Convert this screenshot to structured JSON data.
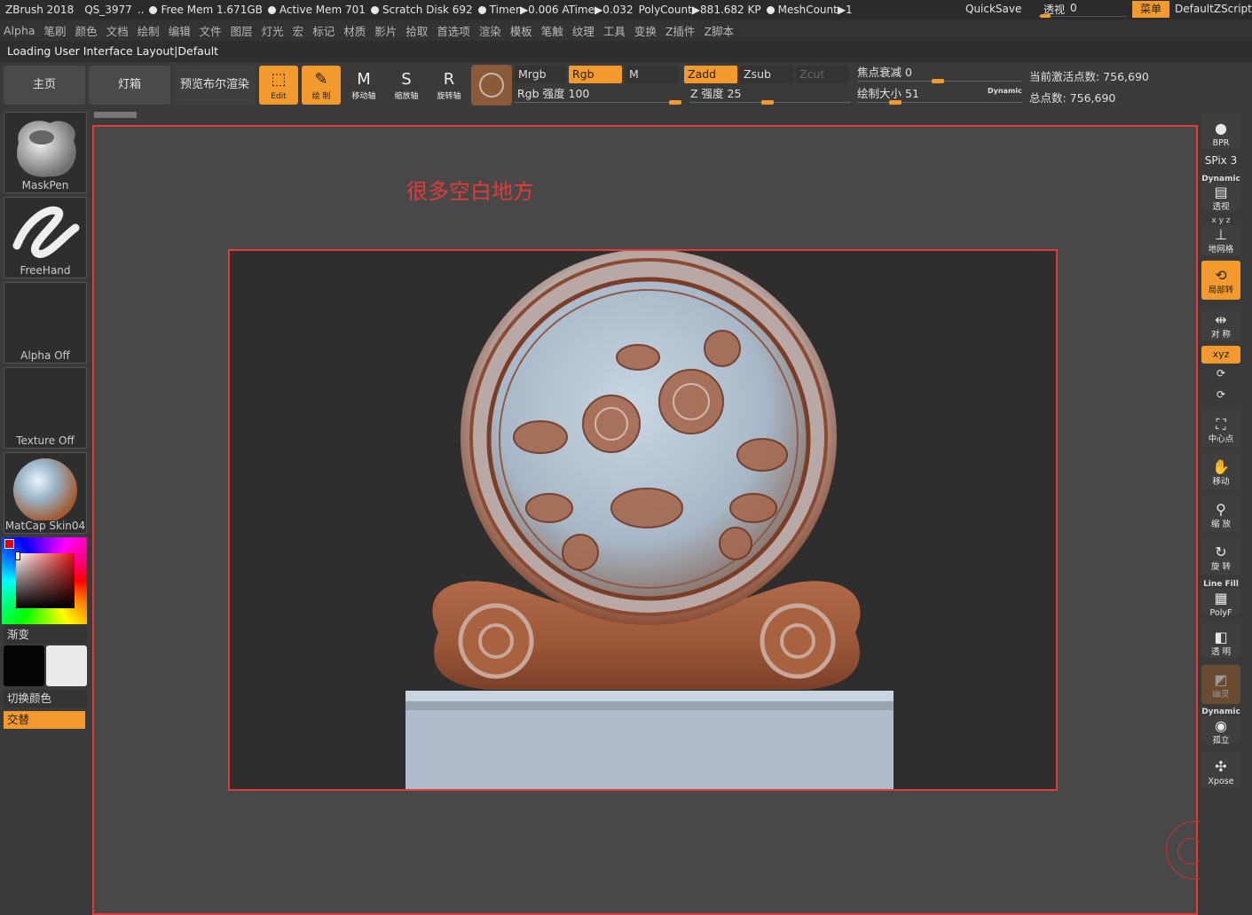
{
  "titlebar": {
    "app": "ZBrush 2018",
    "qs": "QS_3977",
    "ellipsis": "..",
    "free_mem": "Free Mem 1.671GB",
    "active_mem": "Active Mem 701",
    "scratch_disk": "Scratch Disk 692",
    "timer": "Timer▶0.006 ATime▶0.032",
    "polycount": "PolyCount▶881.682 KP",
    "meshcount": "MeshCount▶1",
    "quicksave": "QuickSave",
    "perspective_label": "透视",
    "perspective_value": "0",
    "menu_button": "菜单",
    "default_zscript": "DefaultZScript"
  },
  "menubar": {
    "items": [
      "Alpha",
      "笔刷",
      "颜色",
      "文档",
      "绘制",
      "编辑",
      "文件",
      "图层",
      "灯光",
      "宏",
      "标记",
      "材质",
      "影片",
      "拾取",
      "首选项",
      "渲染",
      "模板",
      "笔触",
      "纹理",
      "工具",
      "变换",
      "Z插件",
      "Z脚本"
    ]
  },
  "status_line": "Loading User Interface Layout|Default",
  "toolbar": {
    "home": "主页",
    "lightbox": "灯箱",
    "preview_bool": "预览布尔渲染",
    "edit": {
      "glyph": "⬚",
      "label": "Edit"
    },
    "draw": {
      "glyph": "✎",
      "label": "绘 制"
    },
    "move": {
      "glyph": "M",
      "label": "移动轴"
    },
    "scale": {
      "glyph": "S",
      "label": "缩放轴"
    },
    "rotate": {
      "glyph": "R",
      "label": "旋转轴"
    },
    "mrgb": "Mrgb",
    "rgb": "Rgb",
    "m": "M",
    "rgb_intensity_label": "Rgb 强度",
    "rgb_intensity_value": "100",
    "zadd": "Zadd",
    "zsub": "Zsub",
    "zcut": "Zcut",
    "z_intensity_label": "Z 强度",
    "z_intensity_value": "25",
    "focal_shift_label": "焦点衰减",
    "focal_shift_value": "0",
    "draw_size_label": "绘制大小",
    "draw_size_value": "51",
    "dynamic": "Dynamic",
    "active_points": "当前激活点数: 756,690",
    "total_points": "总点数: 756,690"
  },
  "leftpanel": {
    "brush": "MaskPen",
    "stroke": "FreeHand",
    "alpha": "Alpha Off",
    "texture": "Texture Off",
    "material": "MatCap Skin04",
    "gradient": "渐变",
    "switch_color": "切换颜色",
    "alternate": "交替"
  },
  "canvas": {
    "annotation": "很多空白地方"
  },
  "rightshelf": {
    "bpr": "BPR",
    "spix": "SPix 3",
    "dynamic": "Dynamic",
    "persp": "透视",
    "xyz_top": "x y z",
    "floor": "地网格",
    "local": "局部转",
    "sym": "对 称",
    "xyz": "xyz",
    "center": "中心点",
    "move": "移动",
    "scale": "缩 放",
    "rotate": "旋 转",
    "linefill": "Line Fill",
    "polyf": "PolyF",
    "transp": "透 明",
    "ghost": "幽灵",
    "solo": "孤立",
    "xpose": "Xpose"
  },
  "colors": {
    "accent": "#f29a2e",
    "annotation_red": "#e33a3a"
  }
}
